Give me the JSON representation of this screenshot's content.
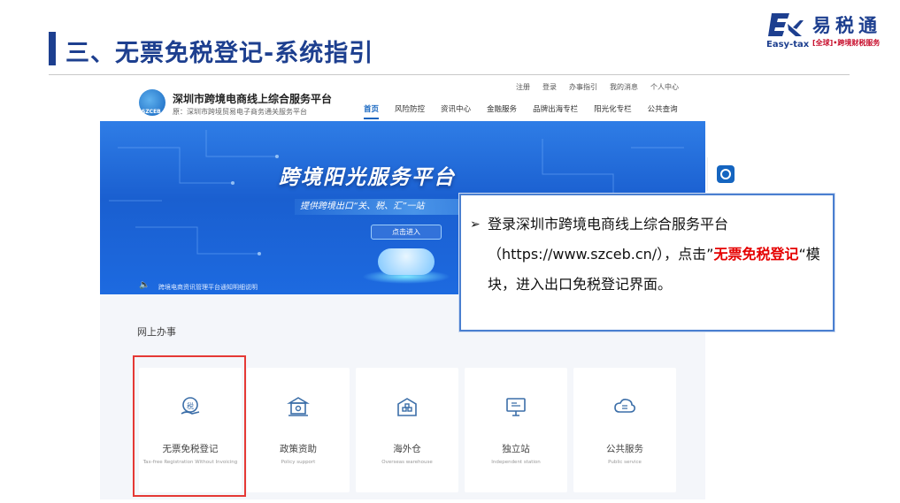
{
  "slide": {
    "title": "三、无票免税登记-系统指引"
  },
  "logo": {
    "cn": "易税通",
    "en": "Easy-tax",
    "sub": "[全球]•跨境财税服务"
  },
  "site": {
    "top_links": [
      "注册",
      "登录",
      "办事指引",
      "我的消息",
      "个人中心"
    ],
    "name": "深圳市跨境电商线上综合服务平台",
    "subname": "原：深圳市跨境贸易电子商务通关服务平台",
    "logo_text": "SZCEB",
    "nav": [
      {
        "label": "首页",
        "active": true
      },
      {
        "label": "风险防控",
        "active": false
      },
      {
        "label": "资讯中心",
        "active": false
      },
      {
        "label": "金融服务",
        "active": false
      },
      {
        "label": "品牌出海专栏",
        "active": false
      },
      {
        "label": "阳光化专栏",
        "active": false
      },
      {
        "label": "公共查询",
        "active": false
      }
    ],
    "banner": {
      "title": "跨境阳光服务平台",
      "subtitle": "提供跨境出口“关、税、汇”一站",
      "button": "点击进入",
      "notice": "跨境电商资讯管理平台通知明细说明"
    },
    "section_title": "网上办事",
    "cards": [
      {
        "label": "无票免税登记",
        "en": "Tax-free Registration Without Invoicing",
        "icon": "tax-hand-icon"
      },
      {
        "label": "政策资助",
        "en": "Policy support",
        "icon": "building-icon"
      },
      {
        "label": "海外仓",
        "en": "Overseas warehouse",
        "icon": "warehouse-icon"
      },
      {
        "label": "独立站",
        "en": "Independent station",
        "icon": "monitor-icon"
      },
      {
        "label": "公共服务",
        "en": "Public service",
        "icon": "cloud-service-icon"
      }
    ]
  },
  "callout": {
    "bullet": "➢",
    "text_1": "登录深圳市跨境电商线上综合服务平台（https://www.szceb.cn/），点击”",
    "red": "无票免税登记",
    "text_2": "“模块，进入出口免税登记界面。"
  },
  "colors": {
    "title_blue": "#1d3f8f",
    "highlight_red": "#e53935",
    "accent_red": "#e50000",
    "site_blue": "#1565c0"
  }
}
